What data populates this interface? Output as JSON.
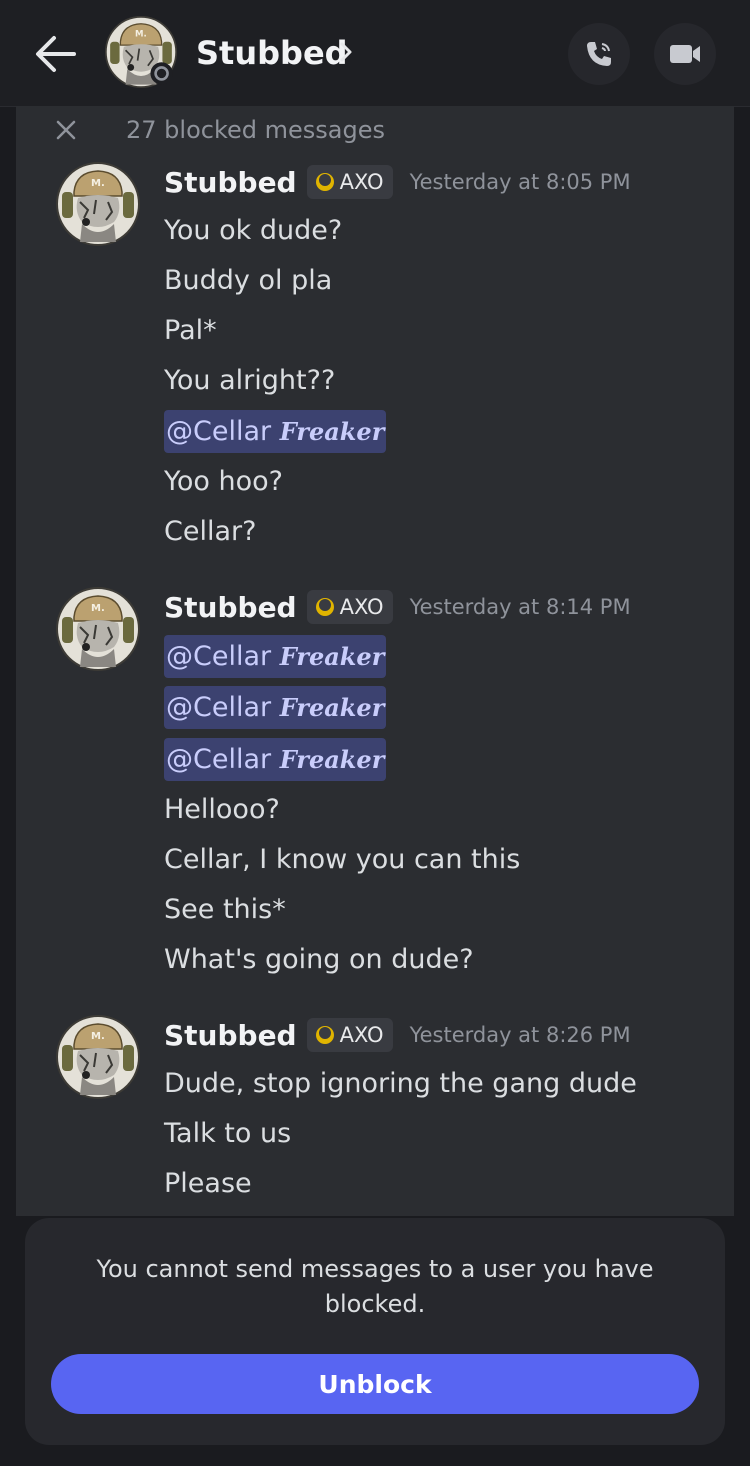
{
  "header": {
    "title": "Stubbed",
    "back_icon": "arrow-left-icon",
    "chevron_icon": "chevron-right-icon",
    "call_icon": "phone-icon",
    "video_icon": "video-camera-icon"
  },
  "blocked_notice": {
    "text": "27 blocked messages",
    "dismiss_icon": "close-icon"
  },
  "messages": [
    {
      "author": "Stubbed",
      "tag": "AXO",
      "timestamp": "Yesterday at 8:05 PM",
      "lines": [
        "You ok dude?",
        "Buddy ol pla",
        "Pal*",
        "You alright??"
      ],
      "mention": {
        "at": "@Cellar",
        "script": "Freaker"
      },
      "lines_after": [
        "Yoo hoo?",
        "Cellar?"
      ]
    },
    {
      "author": "Stubbed",
      "tag": "AXO",
      "timestamp": "Yesterday at 8:14 PM",
      "mentions": [
        {
          "at": "@Cellar",
          "script": "Freaker"
        },
        {
          "at": "@Cellar",
          "script": "Freaker"
        },
        {
          "at": "@Cellar",
          "script": "Freaker"
        }
      ],
      "lines": [
        "Hellooo?",
        "Cellar, I know you can this",
        "See this*",
        "What's going on dude?"
      ]
    },
    {
      "author": "Stubbed",
      "tag": "AXO",
      "timestamp": "Yesterday at 8:26 PM",
      "lines": [
        "Dude, stop ignoring the gang dude",
        "Talk to us",
        "Please"
      ]
    }
  ],
  "footer": {
    "notice": "You cannot send messages to a user you have blocked.",
    "unblock_label": "Unblock"
  },
  "colors": {
    "background": "#1a1b1f",
    "panel": "#2b2d31",
    "accent": "#5865f2",
    "mention_bg": "#3c4270",
    "mention_text": "#c9cdfb"
  }
}
